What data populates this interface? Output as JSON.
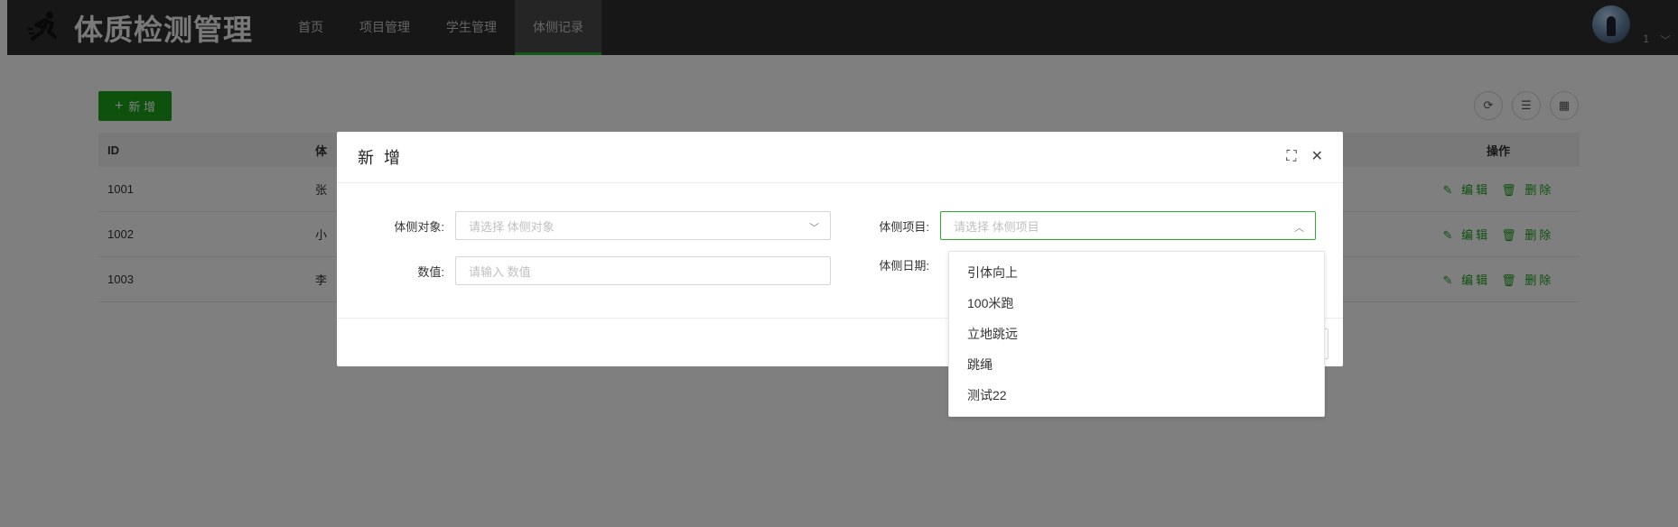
{
  "app": {
    "title": "体质检测管理"
  },
  "nav": [
    {
      "label": "首页"
    },
    {
      "label": "项目管理"
    },
    {
      "label": "学生管理"
    },
    {
      "label": "体侧记录"
    }
  ],
  "user": {
    "name": "1"
  },
  "toolbar": {
    "add_label": "新 增"
  },
  "table": {
    "headers": {
      "id": "ID",
      "name": "体",
      "ops": "操作"
    },
    "rows": [
      {
        "id": "1001",
        "name": "张"
      },
      {
        "id": "1002",
        "name": "小"
      },
      {
        "id": "1003",
        "name": "李"
      }
    ],
    "edit_label": "编辑",
    "delete_label": "删除"
  },
  "modal": {
    "title": "新 增",
    "fields": {
      "subject": {
        "label": "体侧对象:",
        "placeholder": "请选择 体侧对象"
      },
      "project": {
        "label": "体侧项目:",
        "placeholder": "请选择 体侧项目"
      },
      "value": {
        "label": "数值:",
        "placeholder": "请输入 数值"
      },
      "date": {
        "label": "体侧日期:"
      }
    }
  },
  "dropdown": {
    "options": [
      "引体向上",
      "100米跑",
      "立地跳远",
      "跳绳",
      "测试22"
    ]
  },
  "colors": {
    "accent": "#1aa31a",
    "header_bg": "#2f2f2f"
  }
}
